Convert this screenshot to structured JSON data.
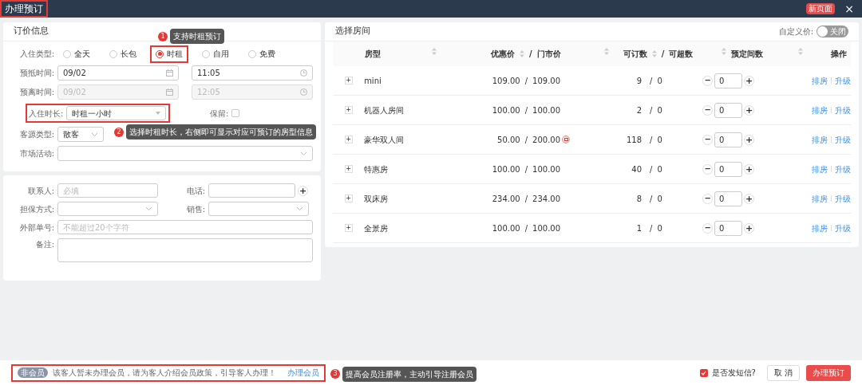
{
  "window": {
    "title": "办理预订",
    "new_page_button": "新页面",
    "close": "×"
  },
  "pricing": {
    "title": "订价信息",
    "stay_type": {
      "label": "入住类型:",
      "options": [
        {
          "label": "全天",
          "selected": false
        },
        {
          "label": "长包",
          "selected": false
        },
        {
          "label": "时租",
          "selected": true
        },
        {
          "label": "自用",
          "selected": false
        },
        {
          "label": "免费",
          "selected": false
        }
      ]
    },
    "arrival": {
      "label": "预抵时间:",
      "date": "09/02",
      "time": "11:05",
      "disabled": false
    },
    "departure": {
      "label": "预离时间:",
      "date": "09/02",
      "time": "12:05",
      "disabled": true
    },
    "duration": {
      "label": "入住时长:",
      "value": "时租一小时"
    },
    "reserve": {
      "label": "保留:",
      "checked": false
    },
    "source": {
      "label": "客源类型:",
      "value": "散客"
    },
    "campaign": {
      "label": "市场活动:"
    }
  },
  "contact": {
    "name": {
      "label": "联系人:",
      "placeholder": "必填"
    },
    "phone": {
      "label": "电话:",
      "add": "+"
    },
    "guarantee": {
      "label": "担保方式:"
    },
    "sales": {
      "label": "销售:"
    },
    "external_no": {
      "label": "外部单号:",
      "placeholder": "不能超过20个字符"
    },
    "remark": {
      "label": "备注:"
    }
  },
  "rooms": {
    "title": "选择房间",
    "custom_price": {
      "label": "自定义价:",
      "on": false,
      "text": "关闭"
    },
    "columns": [
      "房型",
      "优惠价",
      "/",
      "门市价",
      "可订数",
      "/",
      "可超数",
      "预定间数",
      "操作"
    ],
    "rows": [
      {
        "name": "mini",
        "promo": "109.00",
        "rack": "109.00",
        "discount_mark": false,
        "available": "9",
        "overbook": "0",
        "count": "0",
        "actions": [
          "排房",
          "升级"
        ]
      },
      {
        "name": "机器人房间",
        "promo": "100.00",
        "rack": "100.00",
        "discount_mark": false,
        "available": "2",
        "overbook": "0",
        "count": "0",
        "actions": [
          "排房",
          "升级"
        ]
      },
      {
        "name": "豪华双人间",
        "promo": "50.00",
        "rack": "200.00",
        "discount_mark": true,
        "available": "118",
        "overbook": "0",
        "count": "0",
        "actions": [
          "排房",
          "升级"
        ]
      },
      {
        "name": "特惠房",
        "promo": "100.00",
        "rack": "100.00",
        "discount_mark": false,
        "available": "40",
        "overbook": "0",
        "count": "0",
        "actions": [
          "排房",
          "升级"
        ]
      },
      {
        "name": "双床房",
        "promo": "234.00",
        "rack": "234.00",
        "discount_mark": false,
        "available": "8",
        "overbook": "0",
        "count": "0",
        "actions": [
          "排房",
          "升级"
        ]
      },
      {
        "name": "全景房",
        "promo": "100.00",
        "rack": "100.00",
        "discount_mark": false,
        "available": "1",
        "overbook": "0",
        "count": "0",
        "actions": [
          "排房",
          "升级"
        ]
      }
    ],
    "slash": "/",
    "expand": "+",
    "minus": "−",
    "plus": "+"
  },
  "footer": {
    "badge": "非会员",
    "notice": "该客人暂未办理会员，请为客人介绍会员政策，引导客人办理！",
    "link": "办理会员",
    "sms": {
      "label": "是否发短信?",
      "checked": true
    },
    "cancel": "取 消",
    "submit": "办理预订"
  },
  "callouts": [
    {
      "number": "1",
      "text": "支持时租预订"
    },
    {
      "number": "2",
      "text": "选择时租时长，右侧即可显示对应可预订的房型信息"
    },
    {
      "number": "3",
      "text": "提高会员注册率，主动引导注册会员"
    }
  ]
}
